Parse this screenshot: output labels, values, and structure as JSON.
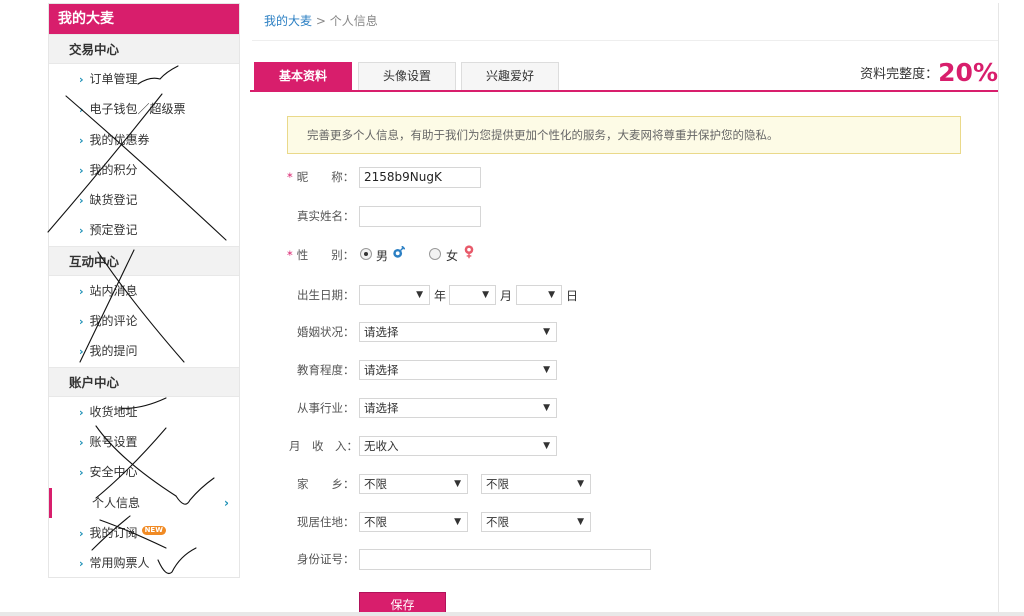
{
  "sidebar": {
    "title": "我的大麦",
    "groups": [
      {
        "label": "交易中心",
        "items": [
          "订单管理",
          "电子钱包／超级票",
          "我的优惠券",
          "我的积分",
          "缺货登记",
          "预定登记"
        ]
      },
      {
        "label": "互动中心",
        "items": [
          "站内消息",
          "我的评论",
          "我的提问"
        ]
      },
      {
        "label": "账户中心",
        "items": [
          "收货地址",
          "账号设置",
          "安全中心",
          "个人信息",
          "我的订阅",
          "常用购票人"
        ]
      }
    ],
    "active_item": "个人信息",
    "new_badge": "NEW"
  },
  "breadcrumb": {
    "home": "我的大麦",
    "separator": ">",
    "current": "个人信息"
  },
  "tabs": [
    "基本资料",
    "头像设置",
    "兴趣爱好"
  ],
  "active_tab": "基本资料",
  "completeness": {
    "label": "资料完整度：",
    "value": "20%"
  },
  "notice": "完善更多个人信息，有助于我们为您提供更加个性化的服务，大麦网将尊重并保护您的隐私。",
  "form": {
    "nickname_label": "昵　　称：",
    "nickname_value": "2158b9NugK",
    "realname_label": "真实姓名：",
    "realname_value": "",
    "gender_label": "性　　别：",
    "gender_male": "男",
    "gender_female": "女",
    "gender_selected": "男",
    "birthday_label": "出生日期：",
    "year_unit": "年",
    "month_unit": "月",
    "day_unit": "日",
    "marital_label": "婚姻状况：",
    "marital_value": "请选择",
    "education_label": "教育程度：",
    "education_value": "请选择",
    "industry_label": "从事行业：",
    "industry_value": "请选择",
    "income_label": "月　收　入：",
    "income_value": "无收入",
    "hometown_label": "家　　乡：",
    "hometown_province": "不限",
    "hometown_city": "不限",
    "residence_label": "现居住地：",
    "residence_province": "不限",
    "residence_city": "不限",
    "idcard_label": "身份证号：",
    "idcard_value": "",
    "save_label": "保存"
  },
  "colors": {
    "accent": "#d81e6c",
    "link": "#2b7fc3",
    "male_icon": "#2b7fc3",
    "female_icon": "#e85a6a"
  }
}
